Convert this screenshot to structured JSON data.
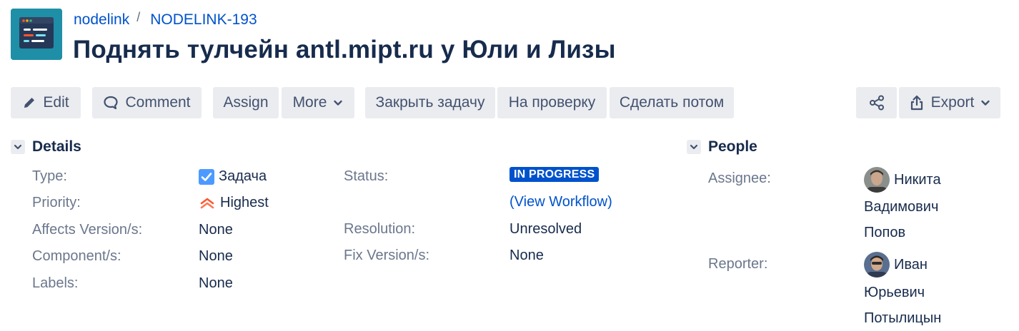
{
  "header": {
    "project": "nodelink",
    "separator": "/",
    "issue_key": "NODELINK-193",
    "title": "Поднять тулчейн antl.mipt.ru у Юли и Лизы"
  },
  "toolbar": {
    "edit": "Edit",
    "comment": "Comment",
    "assign": "Assign",
    "more": "More",
    "close_task": "Закрыть задачу",
    "to_review": "На проверку",
    "do_later": "Сделать потом",
    "export": "Export"
  },
  "details": {
    "heading": "Details",
    "type_label": "Type:",
    "type_value": "Задача",
    "priority_label": "Priority:",
    "priority_value": "Highest",
    "affects_label": "Affects Version/s:",
    "affects_value": "None",
    "component_label": "Component/s:",
    "component_value": "None",
    "labels_label": "Labels:",
    "labels_value": "None",
    "status_label": "Status:",
    "status_value": "IN PROGRESS",
    "workflow_open": "(",
    "workflow_link": "View Workflow",
    "workflow_close": ")",
    "resolution_label": "Resolution:",
    "resolution_value": "Unresolved",
    "fix_label": "Fix Version/s:",
    "fix_value": "None"
  },
  "people": {
    "heading": "People",
    "assignee_label": "Assignee:",
    "assignee_line1": "Никита",
    "assignee_line2": "Вадимович",
    "assignee_line3": "Попов",
    "reporter_label": "Reporter:",
    "reporter_line1": "Иван",
    "reporter_line2": "Юрьевич",
    "reporter_line3": "Потылицын"
  },
  "colors": {
    "link": "#0052cc",
    "status_lozenge": "#0052cc",
    "button_bg": "#ebecf0",
    "priority_highest": "#ff5630",
    "checkbox": "#4c9aff"
  },
  "icons": {
    "edit": "pencil-icon",
    "comment": "comment-bubble-icon",
    "more": "chevron-down-icon",
    "share": "share-icon",
    "export": "export-icon",
    "type": "task-checkbox-icon",
    "priority": "highest-priority-icon"
  }
}
